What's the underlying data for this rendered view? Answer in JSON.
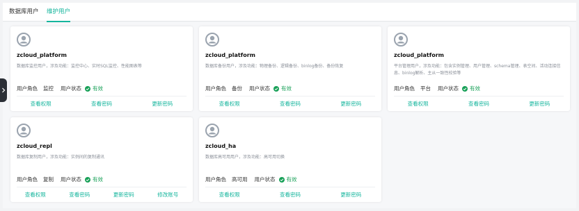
{
  "tabs": [
    {
      "label": "数据库用户"
    },
    {
      "label": "维护用户"
    }
  ],
  "icons": {
    "avatar": "user-avatar-icon",
    "status": "check-circle-icon",
    "side_handle": "chevron-right-icon"
  },
  "colors": {
    "accent": "#15b59d",
    "status_ok": "#18a058",
    "avatar": "#9aa3ae"
  },
  "cards": [
    {
      "name": "zcloud_platform",
      "desc": "数据库监控用户，涉及功能：监控中心、实时SQL监控、性能图表等",
      "role_label": "用户角色",
      "role_value": "监控",
      "status_label": "用户状态",
      "status_value": "有效",
      "actions": [
        "查看权限",
        "查看密码",
        "更新密码"
      ]
    },
    {
      "name": "zcloud_platform",
      "desc": "数据库备份用户，涉及功能：物理备份、逻辑备份、binlog备份、备份恢复",
      "role_label": "用户角色",
      "role_value": "备份",
      "status_label": "用户状态",
      "status_value": "有效",
      "actions": [
        "查看权限",
        "查看密码",
        "更新密码"
      ]
    },
    {
      "name": "zcloud_platform",
      "desc": "平台管理用户，涉及功能：包含实例管理、用户管理、schema管理、表空间、活动连接信息、binlog解析、主从一致性校验等",
      "role_label": "用户角色",
      "role_value": "平台",
      "status_label": "用户状态",
      "status_value": "有效",
      "actions": [
        "查看权限",
        "查看密码",
        "更新密码"
      ]
    },
    {
      "name": "zcloud_repl",
      "desc": "数据库复制用户，涉及功能：实例间的复制通讯",
      "role_label": "用户角色",
      "role_value": "复制",
      "status_label": "用户状态",
      "status_value": "有效",
      "actions": [
        "查看权限",
        "查看密码",
        "更新密码",
        "修改账号"
      ]
    },
    {
      "name": "zcloud_ha",
      "desc": "数据库高可用用户，涉及功能：高可用切换",
      "role_label": "用户角色",
      "role_value": "高可用",
      "status_label": "用户状态",
      "status_value": "有效",
      "actions": [
        "查看权限",
        "查看密码",
        "更新密码"
      ]
    }
  ]
}
